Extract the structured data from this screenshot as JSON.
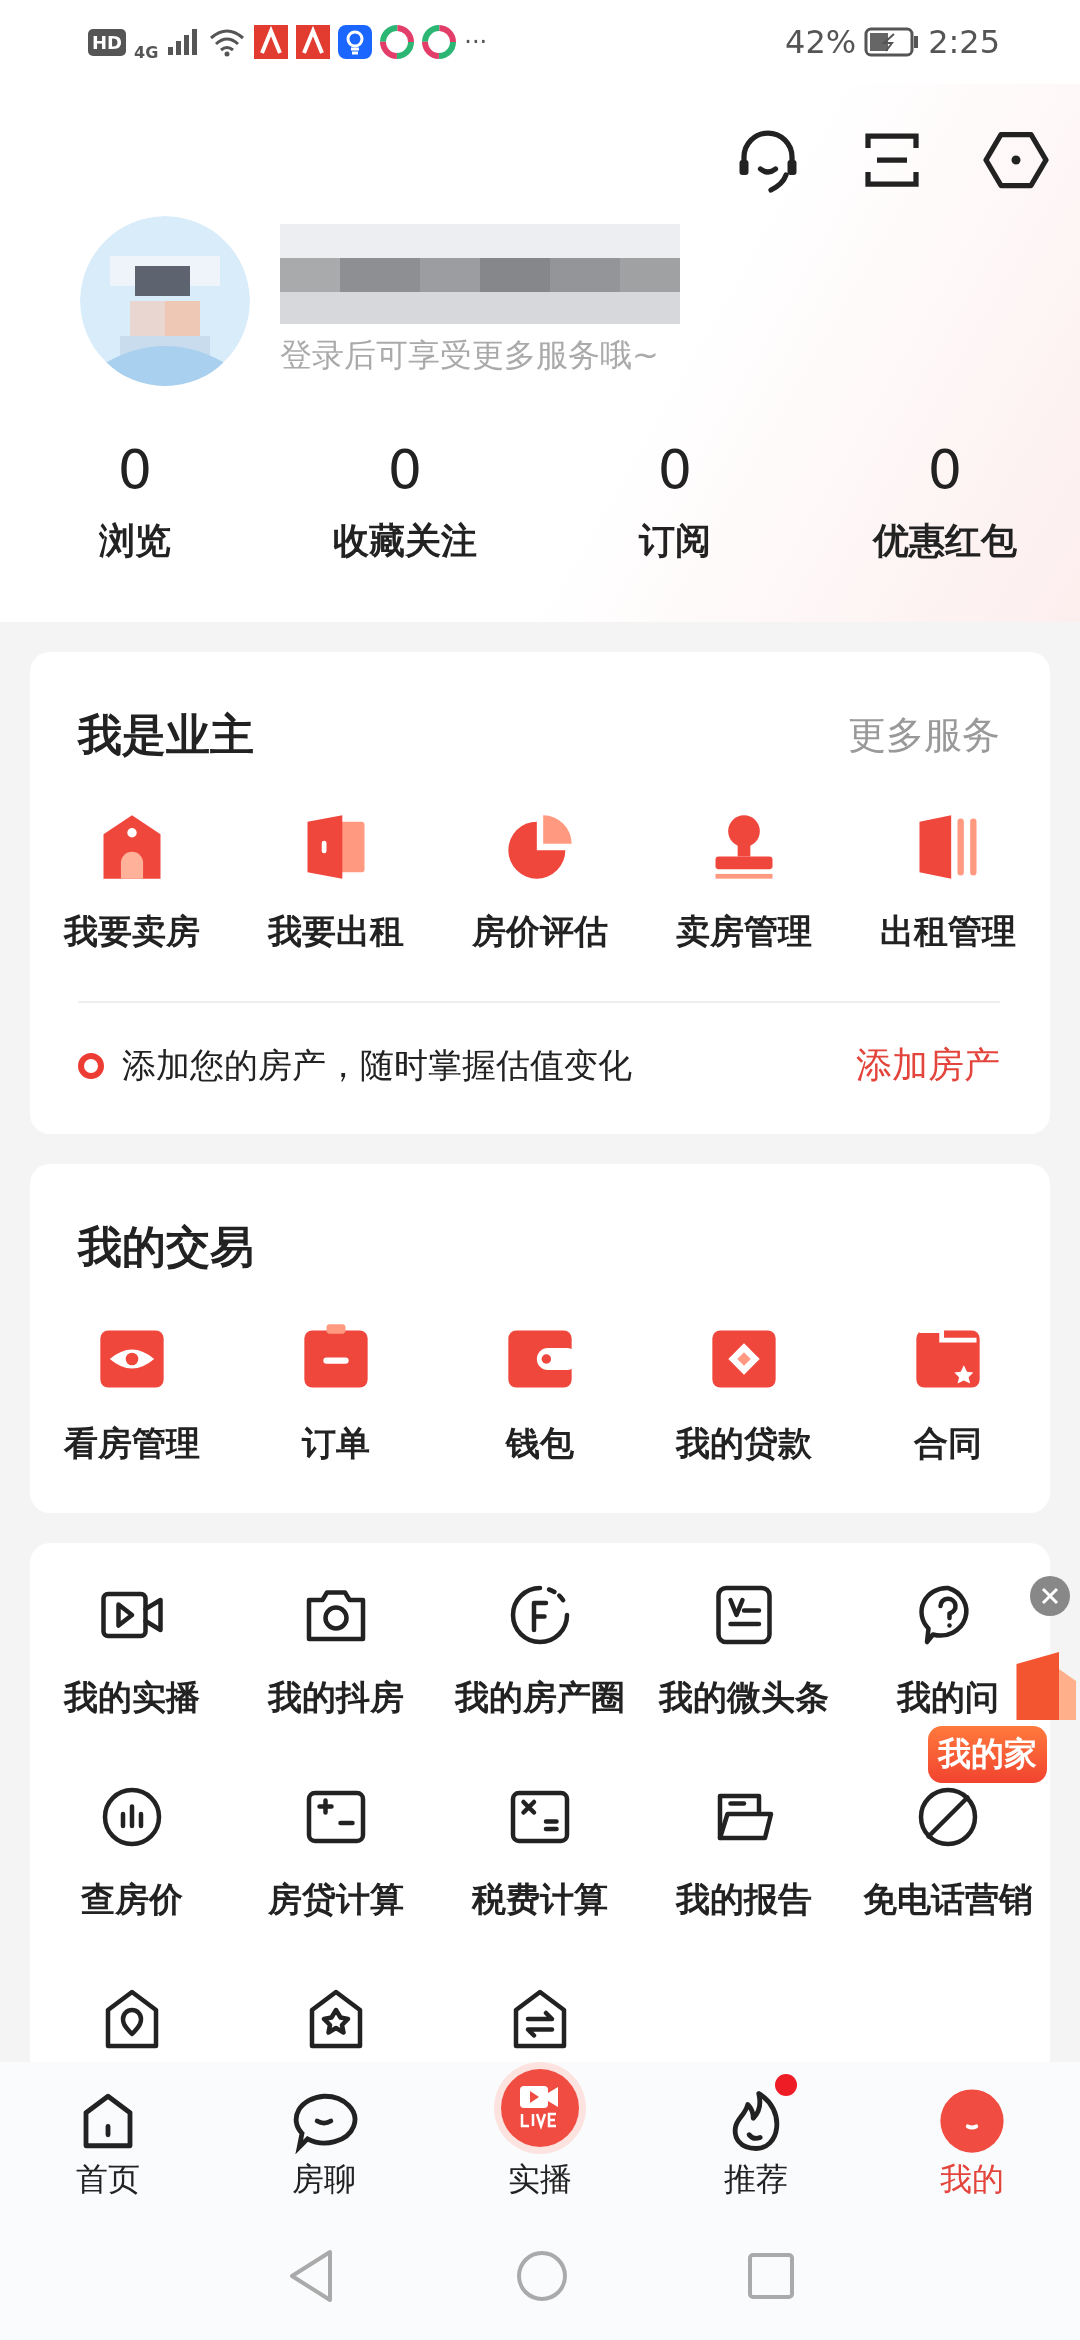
{
  "status_bar": {
    "hd": "HD",
    "network": "4G",
    "more": "···",
    "battery": "42%",
    "time": "2:25"
  },
  "profile": {
    "subtitle": "登录后可享受更多服务哦~"
  },
  "stats": [
    {
      "value": "0",
      "label": "浏览"
    },
    {
      "value": "0",
      "label": "收藏关注"
    },
    {
      "value": "0",
      "label": "订阅"
    },
    {
      "value": "0",
      "label": "优惠红包"
    }
  ],
  "owner_card": {
    "title": "我是业主",
    "more": "更多服务",
    "items": [
      "我要卖房",
      "我要出租",
      "房价评估",
      "卖房管理",
      "出租管理"
    ],
    "tip": "添加您的房产，随时掌握估值变化",
    "tip_action": "添加房产"
  },
  "trade_card": {
    "title": "我的交易",
    "items": [
      "看房管理",
      "订单",
      "钱包",
      "我的贷款",
      "合同"
    ]
  },
  "tools": {
    "items": [
      "我的实播",
      "我的抖房",
      "我的房产圈",
      "我的微头条",
      "我的问",
      "查房价",
      "房贷计算",
      "税费计算",
      "我的报告",
      "免电话营销"
    ]
  },
  "floating_badge": {
    "label": "我的家"
  },
  "tab_bar": [
    {
      "label": "首页",
      "selected": false,
      "dot": false
    },
    {
      "label": "房聊",
      "selected": false,
      "dot": false
    },
    {
      "label": "实播",
      "selected": false,
      "dot": false
    },
    {
      "label": "推荐",
      "selected": false,
      "dot": true
    },
    {
      "label": "我的",
      "selected": true,
      "dot": false
    }
  ]
}
